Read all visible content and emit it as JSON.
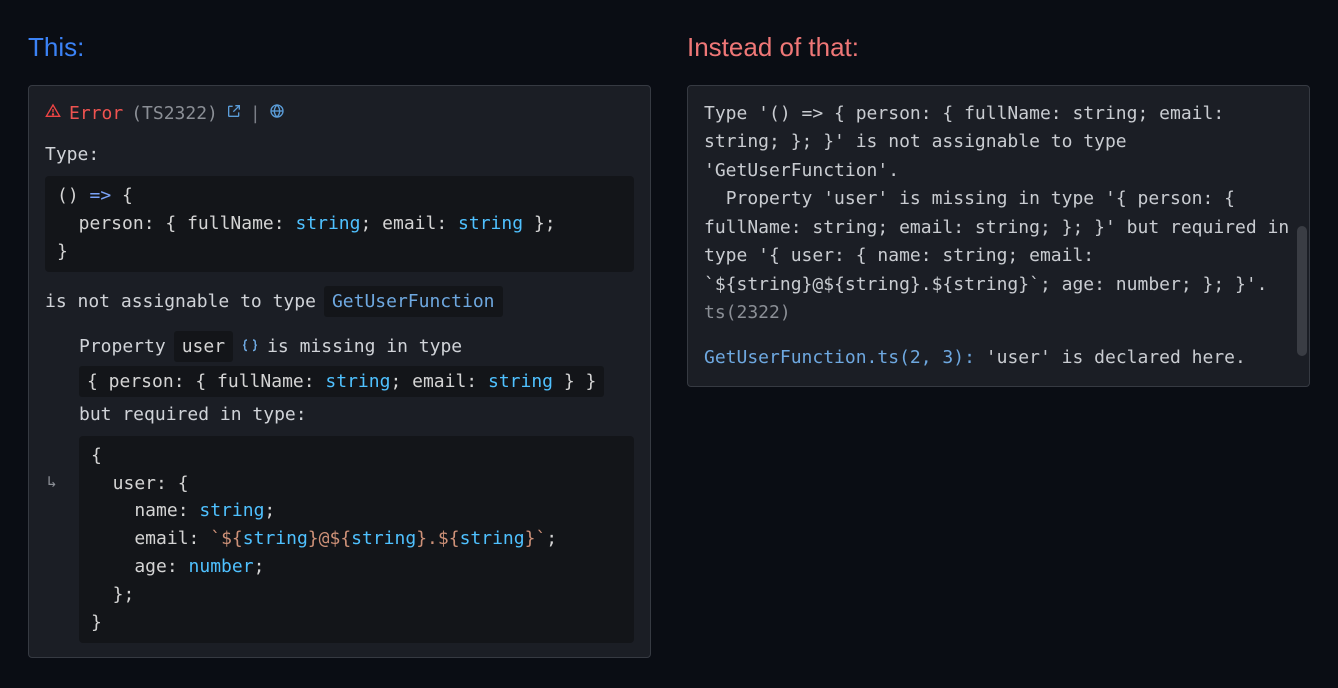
{
  "left": {
    "heading": "This:",
    "header": {
      "error_label": "Error",
      "code": "(TS2322)",
      "pipe": "|"
    },
    "line_type_label": "Type:",
    "code1": {
      "l1_a": "()",
      "l1_b": " => ",
      "l1_c": "{",
      "l2_a": "  person",
      "l2_b": ": { ",
      "l2_c": "fullName",
      "l2_d": ": ",
      "l2_e": "string",
      "l2_f": "; ",
      "l2_g": "email",
      "l2_h": ": ",
      "l2_i": "string",
      "l2_j": " };",
      "l3": "}"
    },
    "not_assignable": "is not assignable to type",
    "target_type": "GetUserFunction",
    "prop_label": "Property",
    "prop_name": "user",
    "missing_tail": "is missing in type",
    "inline_type": {
      "a": "{ person: { fullName: ",
      "b": "string",
      "c": "; email: ",
      "d": "string",
      "e": " } }"
    },
    "but_required": "but required in type:",
    "arrow": "↳",
    "code2": {
      "l1": "{",
      "l2_a": "  user",
      "l2_b": ": {",
      "l3_a": "    name",
      "l3_b": ": ",
      "l3_c": "string",
      "l3_d": ";",
      "l4_a": "    email",
      "l4_b": ": ",
      "l4_c": "`",
      "l4_d": "${",
      "l4_e": "string",
      "l4_f": "}",
      "l4_g": "@",
      "l4_h": "${",
      "l4_i": "string",
      "l4_j": "}",
      "l4_k": ".",
      "l4_l": "${",
      "l4_m": "string",
      "l4_n": "}",
      "l4_o": "`",
      "l4_p": ";",
      "l5_a": "    age",
      "l5_b": ": ",
      "l5_c": "number",
      "l5_d": ";",
      "l6": "  };",
      "l7": "}"
    }
  },
  "right": {
    "heading": "Instead of that:",
    "body_a": "Type '() => { person: { fullName: string; email: string; }; }' is not assignable to type 'GetUserFunction'.",
    "body_b": "  Property 'user' is missing in type '{ person: { fullName: string; email: string; }; }' but required in type '{ user: { name: string; email: `${string}@${string}.${string}`; age: number; }; }'.",
    "ts_code": " ts(2322)",
    "link": "GetUserFunction.ts(2, 3):",
    "link_tail": " 'user' is declared here."
  }
}
